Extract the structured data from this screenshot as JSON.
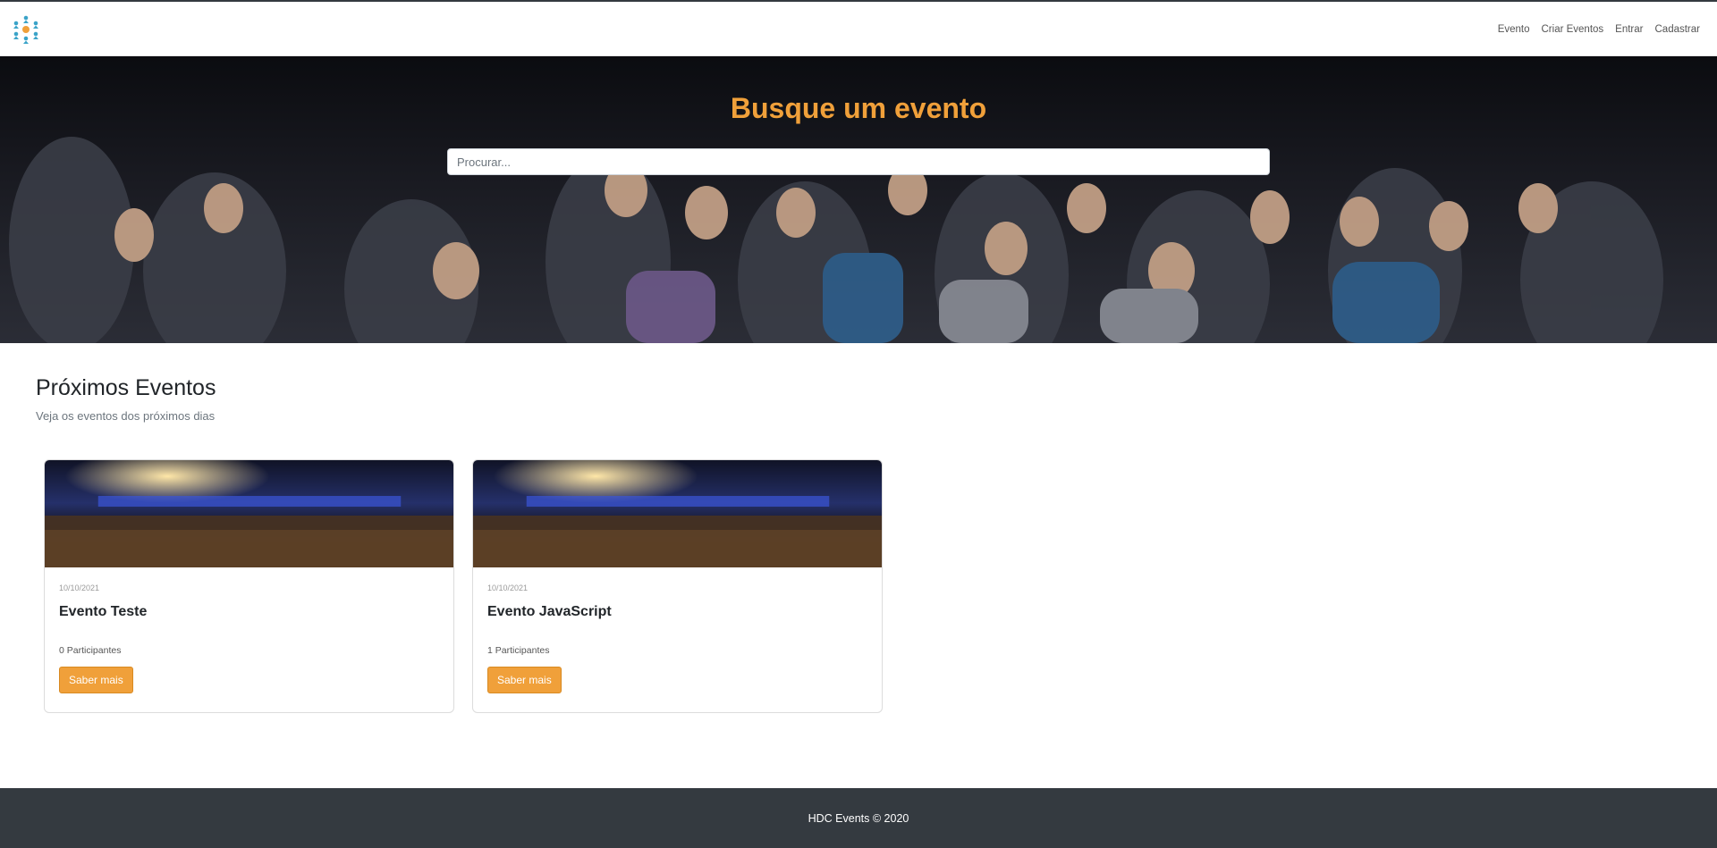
{
  "nav": {
    "links": [
      "Evento",
      "Criar Eventos",
      "Entrar",
      "Cadastrar"
    ]
  },
  "hero": {
    "title": "Busque um evento",
    "search_placeholder": "Procurar..."
  },
  "events_section": {
    "title": "Próximos Eventos",
    "subtitle": "Veja os eventos dos próximos dias"
  },
  "events": [
    {
      "date": "10/10/2021",
      "title": "Evento Teste",
      "participants": "0 Participantes",
      "button": "Saber mais"
    },
    {
      "date": "10/10/2021",
      "title": "Evento JavaScript",
      "participants": "1 Participantes",
      "button": "Saber mais"
    }
  ],
  "footer": {
    "text": "HDC Events © 2020"
  },
  "colors": {
    "accent": "#f0a03a",
    "footer_bg": "#343a40"
  },
  "icons": {
    "logo": "people-network-logo"
  }
}
